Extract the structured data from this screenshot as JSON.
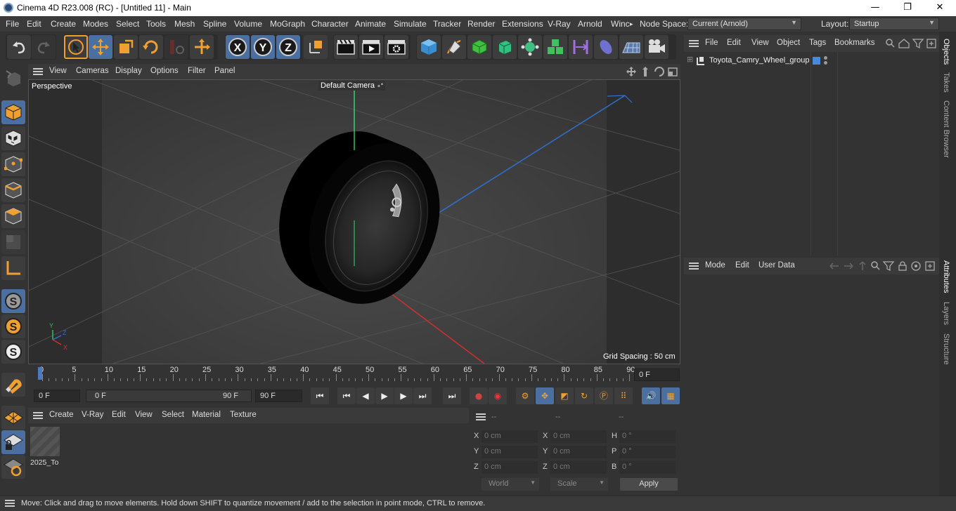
{
  "window": {
    "title": "Cinema 4D R23.008 (RC) - [Untitled 11] - Main",
    "minimize_glyph": "—",
    "maximize_glyph": "❐",
    "close_glyph": "✕"
  },
  "menubar": {
    "items": [
      "File",
      "Edit",
      "Create",
      "Modes",
      "Select",
      "Tools",
      "Mesh",
      "Spline",
      "Volume",
      "MoGraph",
      "Character",
      "Animate",
      "Simulate",
      "Tracker",
      "Render",
      "Extensions",
      "V-Ray",
      "Arnold",
      "Winc"
    ],
    "overflow_glyph": "▸",
    "node_space_label": "Node Space:",
    "node_space_value": "Current (Arnold)",
    "layout_label": "Layout:",
    "layout_value": "Startup"
  },
  "viewport": {
    "menu": [
      "View",
      "Cameras",
      "Display",
      "Options",
      "Filter",
      "Panel"
    ],
    "view_name": "Perspective",
    "camera_name": "Default Camera",
    "grid_spacing": "Grid Spacing : 50 cm",
    "axis_labels": {
      "y": "Y",
      "z": "Z",
      "x": "X"
    }
  },
  "timeline": {
    "ticks": [
      "0",
      "5",
      "10",
      "15",
      "20",
      "25",
      "30",
      "35",
      "40",
      "45",
      "50",
      "55",
      "60",
      "65",
      "70",
      "75",
      "80",
      "85",
      "90"
    ],
    "current_frame_field": "0 F",
    "start_field": "0 F",
    "range_start": "0 F",
    "range_end": "90 F",
    "end_field": "90 F"
  },
  "material_manager": {
    "menu": [
      "Create",
      "V-Ray",
      "Edit",
      "View",
      "Select",
      "Material",
      "Texture"
    ],
    "materials": [
      {
        "name": "2025_To"
      }
    ]
  },
  "coordinates": {
    "header": [
      "--",
      "--",
      "--"
    ],
    "rows": [
      {
        "a_label": "X",
        "a_val": "0 cm",
        "b_label": "X",
        "b_val": "0 cm",
        "c_label": "H",
        "c_val": "0 °"
      },
      {
        "a_label": "Y",
        "a_val": "0 cm",
        "b_label": "Y",
        "b_val": "0 cm",
        "c_label": "P",
        "c_val": "0 °"
      },
      {
        "a_label": "Z",
        "a_val": "0 cm",
        "b_label": "Z",
        "b_val": "0 cm",
        "c_label": "B",
        "c_val": "0 °"
      }
    ],
    "mode_select": "World",
    "scale_select": "Scale",
    "apply_label": "Apply"
  },
  "objects_panel": {
    "menu": [
      "File",
      "Edit",
      "View",
      "Object",
      "Tags",
      "Bookmarks"
    ],
    "objects": [
      {
        "name": "Toyota_Camry_Wheel_group"
      }
    ]
  },
  "attributes_panel": {
    "menu": [
      "Mode",
      "Edit",
      "User Data"
    ]
  },
  "side_tabs": {
    "top": [
      "Objects",
      "Takes",
      "Content Browser"
    ],
    "bottom": [
      "Attributes",
      "Layers",
      "Structure"
    ]
  },
  "status": {
    "text": "Move: Click and drag to move elements. Hold down SHIFT to quantize movement / add to the selection in point mode, CTRL to remove."
  },
  "colors": {
    "accent": "#4a6fa0",
    "orange": "#f0a030",
    "x_axis": "#d03030",
    "y_axis": "#30c060",
    "z_axis": "#3070d0"
  }
}
